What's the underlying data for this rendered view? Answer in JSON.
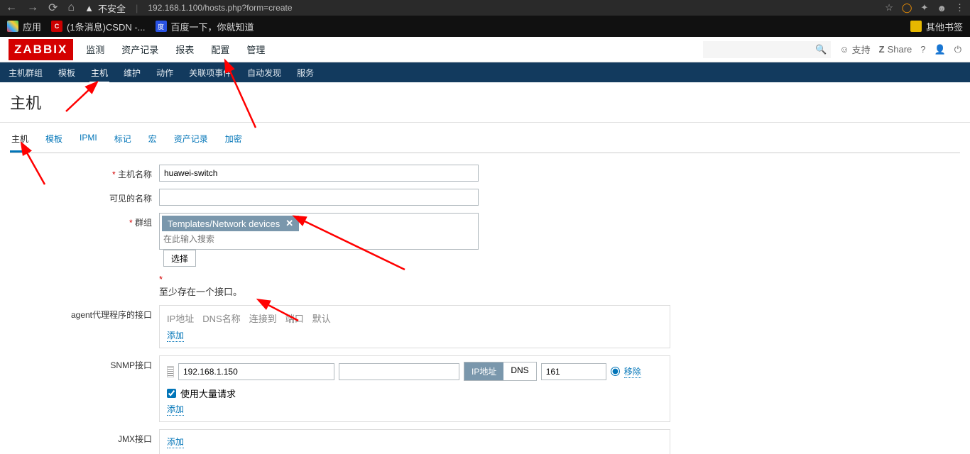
{
  "browser": {
    "insecure": "不安全",
    "url": "192.168.1.100/hosts.php?form=create"
  },
  "bookmarks": {
    "apps": "应用",
    "csdn": "(1条消息)CSDN -...",
    "baidu": "百度一下，你就知道",
    "other": "其他书签"
  },
  "zbx": {
    "logo": "ZABBIX",
    "menu": {
      "monitor": "监测",
      "inventory": "资产记录",
      "reports": "报表",
      "config": "配置",
      "admin": "管理"
    },
    "support": "支持",
    "share": "Share"
  },
  "subnav": {
    "hostgroups": "主机群组",
    "templates": "模板",
    "hosts": "主机",
    "maintenance": "维护",
    "actions": "动作",
    "correlation": "关联项事件",
    "discovery": "自动发现",
    "services": "服务"
  },
  "page": {
    "title": "主机"
  },
  "tabs": {
    "host": "主机",
    "templates": "模板",
    "ipmi": "IPMI",
    "tags": "标记",
    "macros": "宏",
    "inventory": "资产记录",
    "encryption": "加密"
  },
  "form": {
    "hostname_label": "主机名称",
    "hostname_value": "huawei-switch",
    "visiblename_label": "可见的名称",
    "visiblename_value": "",
    "groups_label": "群组",
    "groups_tag": "Templates/Network devices",
    "groups_placeholder": "在此输入搜索",
    "select_btn": "选择",
    "iface_required": "至少存在一个接口。",
    "agent_label": "agent代理程序的接口",
    "iface_hdr": {
      "ip": "IP地址",
      "dns": "DNS名称",
      "connect": "连接到",
      "port": "端口",
      "default": "默认"
    },
    "add_link": "添加",
    "snmp_label": "SNMP接口",
    "snmp_ip": "192.168.1.150",
    "snmp_port": "161",
    "toggle_ip": "IP地址",
    "toggle_dns": "DNS",
    "remove": "移除",
    "bulk": "使用大量请求",
    "jmx_label": "JMX接口"
  }
}
